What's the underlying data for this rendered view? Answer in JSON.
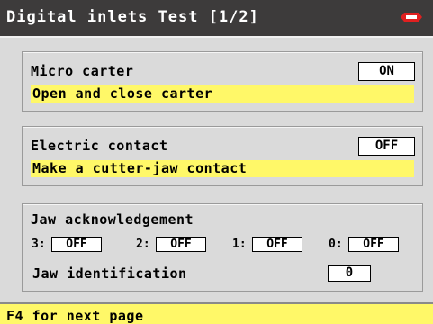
{
  "title": "Digital inlets Test [1/2]",
  "logo_icon": "brand-logo-icon",
  "colors": {
    "titlebar": "#3d3b3b",
    "panel": "#dadada",
    "hint": "#fff868",
    "logo": "#e02020"
  },
  "micro_carter": {
    "label": "Micro carter",
    "value": "ON",
    "hint": "Open and close carter"
  },
  "electric_contact": {
    "label": "Electric contact",
    "value": "OFF",
    "hint": "Make a cutter-jaw contact"
  },
  "jaw": {
    "heading": "Jaw acknowledgement",
    "inputs": [
      {
        "label": "3:",
        "value": "OFF"
      },
      {
        "label": "2:",
        "value": "OFF"
      },
      {
        "label": "1:",
        "value": "OFF"
      },
      {
        "label": "0:",
        "value": "OFF"
      }
    ],
    "identification_label": "Jaw identification",
    "identification_value": "0"
  },
  "footer": "F4 for next page"
}
